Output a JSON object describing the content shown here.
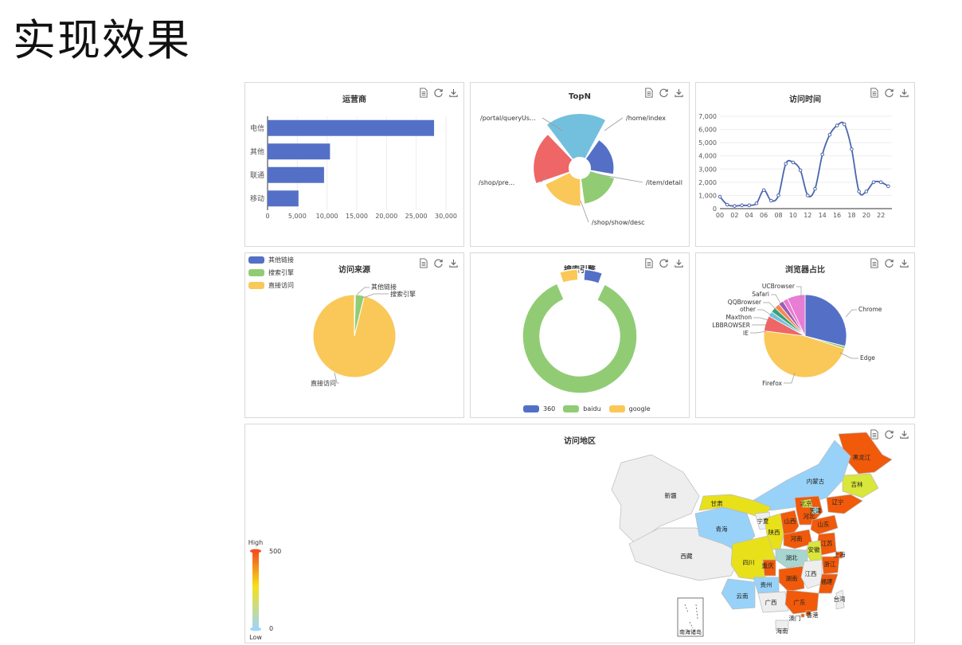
{
  "page": {
    "title": "实现效果"
  },
  "panels": {
    "operator": "运营商",
    "topn": "TopN",
    "visit_time": "访问时间",
    "visit_source": "访问来源",
    "search_engine": "搜索引擎",
    "browser": "浏览器占比",
    "region": "访问地区"
  },
  "colors": {
    "blue": "#5470c6",
    "green": "#91cc75",
    "yellow": "#fac858",
    "red": "#ee6666",
    "cyan": "#73c0de",
    "teal": "#3ba272",
    "orange": "#fc8452",
    "purple": "#9a60b4",
    "pink": "#ea7ccc"
  },
  "chart_data": [
    {
      "id": "operator",
      "type": "bar",
      "orientation": "horizontal",
      "title": "运营商",
      "categories": [
        "电信",
        "其他",
        "联通",
        "移动"
      ],
      "values": [
        28000,
        10500,
        9500,
        5200
      ],
      "xlim": [
        0,
        30000
      ],
      "xticks": [
        "0",
        "5,000",
        "10,000",
        "15,000",
        "20,000",
        "25,000",
        "30,000"
      ]
    },
    {
      "id": "topn",
      "type": "pie",
      "variant": "rose",
      "title": "TopN",
      "slices": [
        {
          "name": "/home/index",
          "value": 4
        },
        {
          "name": "/item/detail",
          "value": 4.5
        },
        {
          "name": "/shop/show/desc",
          "value": 5
        },
        {
          "name": "/shop/pre...",
          "value": 7
        },
        {
          "name": "/portal/queryUs...",
          "value": 9
        }
      ]
    },
    {
      "id": "visit_time",
      "type": "line",
      "title": "访问时间",
      "x": [
        0,
        1,
        2,
        3,
        4,
        5,
        6,
        7,
        8,
        9,
        10,
        11,
        12,
        13,
        14,
        15,
        16,
        17,
        18,
        19,
        20,
        21,
        22,
        23
      ],
      "xticks": [
        "00",
        "02",
        "04",
        "06",
        "08",
        "10",
        "12",
        "14",
        "16",
        "18",
        "20",
        "22"
      ],
      "values": [
        900,
        300,
        200,
        250,
        250,
        400,
        1400,
        600,
        1000,
        3400,
        3500,
        2900,
        1000,
        1500,
        4100,
        5600,
        6300,
        6400,
        4500,
        1300,
        1300,
        2000,
        2000,
        1700
      ],
      "ylim": [
        0,
        7000
      ],
      "yticks": [
        "0",
        "1,000",
        "2,000",
        "3,000",
        "4,000",
        "5,000",
        "6,000",
        "7,000"
      ]
    },
    {
      "id": "visit_source",
      "type": "pie",
      "title": "访问来源",
      "slices": [
        {
          "name": "其他链接",
          "value": 0.4
        },
        {
          "name": "搜索引擎",
          "value": 3.5
        },
        {
          "name": "直接访问",
          "value": 96.1
        }
      ],
      "legend": [
        "其他链接",
        "搜索引擎",
        "直接访问"
      ]
    },
    {
      "id": "search_engine",
      "type": "pie",
      "variant": "donut",
      "title": "搜索引擎",
      "slices": [
        {
          "name": "360",
          "value": 6
        },
        {
          "name": "baidu",
          "value": 88
        },
        {
          "name": "google",
          "value": 6
        }
      ],
      "legend": [
        "360",
        "baidu",
        "google"
      ]
    },
    {
      "id": "browser",
      "type": "pie",
      "title": "浏览器占比",
      "slices": [
        {
          "name": "Chrome",
          "value": 29
        },
        {
          "name": "Edge",
          "value": 1
        },
        {
          "name": "Firefox",
          "value": 47
        },
        {
          "name": "IE",
          "value": 6
        },
        {
          "name": "LBBROWSER",
          "value": 2
        },
        {
          "name": "Maxthon",
          "value": 2
        },
        {
          "name": "other",
          "value": 2
        },
        {
          "name": "QQBrowser",
          "value": 2
        },
        {
          "name": "Safari",
          "value": 2
        },
        {
          "name": "UCBrowser",
          "value": 7
        }
      ]
    },
    {
      "id": "region",
      "type": "map",
      "title": "访问地区",
      "visual_map": {
        "min": 0,
        "max": 500,
        "high_label": "High",
        "low_label": "Low",
        "max_label": "500",
        "min_label": "0"
      },
      "regions": [
        {
          "name": "黑龙江",
          "value": 500
        },
        {
          "name": "吉林",
          "value": 150
        },
        {
          "name": "辽宁",
          "value": 500
        },
        {
          "name": "内蒙古",
          "value": 80
        },
        {
          "name": "新疆",
          "value": 0
        },
        {
          "name": "西藏",
          "value": 0
        },
        {
          "name": "甘肃",
          "value": 280
        },
        {
          "name": "青海",
          "value": 80
        },
        {
          "name": "宁夏",
          "value": 0
        },
        {
          "name": "陕西",
          "value": 280
        },
        {
          "name": "山西",
          "value": 500
        },
        {
          "name": "河北",
          "value": 500
        },
        {
          "name": "北京",
          "value": 150
        },
        {
          "name": "天津",
          "value": 100
        },
        {
          "name": "山东",
          "value": 500
        },
        {
          "name": "河南",
          "value": 500
        },
        {
          "name": "江苏",
          "value": 500
        },
        {
          "name": "安徽",
          "value": 150
        },
        {
          "name": "上海",
          "value": 500
        },
        {
          "name": "浙江",
          "value": 500
        },
        {
          "name": "湖北",
          "value": 100
        },
        {
          "name": "四川",
          "value": 260
        },
        {
          "name": "重庆",
          "value": 500
        },
        {
          "name": "湖南",
          "value": 500
        },
        {
          "name": "江西",
          "value": 0
        },
        {
          "name": "福建",
          "value": 500
        },
        {
          "name": "贵州",
          "value": 80
        },
        {
          "name": "云南",
          "value": 80
        },
        {
          "name": "广西",
          "value": 0
        },
        {
          "name": "广东",
          "value": 500
        },
        {
          "name": "香港",
          "value": 500
        },
        {
          "name": "澳门",
          "value": 500
        },
        {
          "name": "海南",
          "value": 0
        },
        {
          "name": "台湾",
          "value": 0
        },
        {
          "name": "南海诸岛",
          "value": 0
        }
      ]
    }
  ]
}
